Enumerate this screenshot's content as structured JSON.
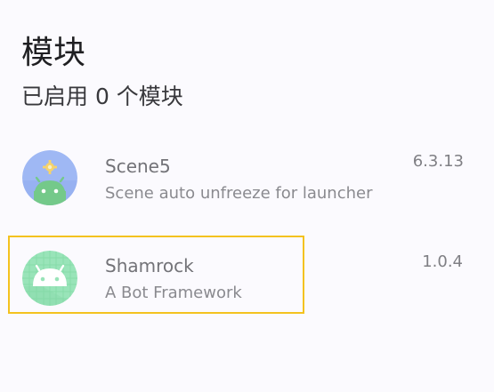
{
  "header": {
    "title": "模块",
    "subtitle": "已启用 0 个模块"
  },
  "modules": [
    {
      "name": "Scene5",
      "description": "Scene auto unfreeze for launcher",
      "version": "6.3.13",
      "icon": "android-gear-icon",
      "icon_colors": {
        "background": "#9fb8f4",
        "android": "#74c98a",
        "gear": "#f5d36b"
      }
    },
    {
      "name": "Shamrock",
      "description": "A Bot Framework",
      "version": "1.0.4",
      "icon": "android-grid-icon",
      "icon_colors": {
        "background": "#99e4b9",
        "android": "#ffffff",
        "grid": "#86dca9"
      },
      "highlighted": true
    }
  ],
  "colors": {
    "page_background": "#fbfafe",
    "highlight": "#f4c21f",
    "title": "#1f1f22",
    "secondary_text": "#737378"
  }
}
